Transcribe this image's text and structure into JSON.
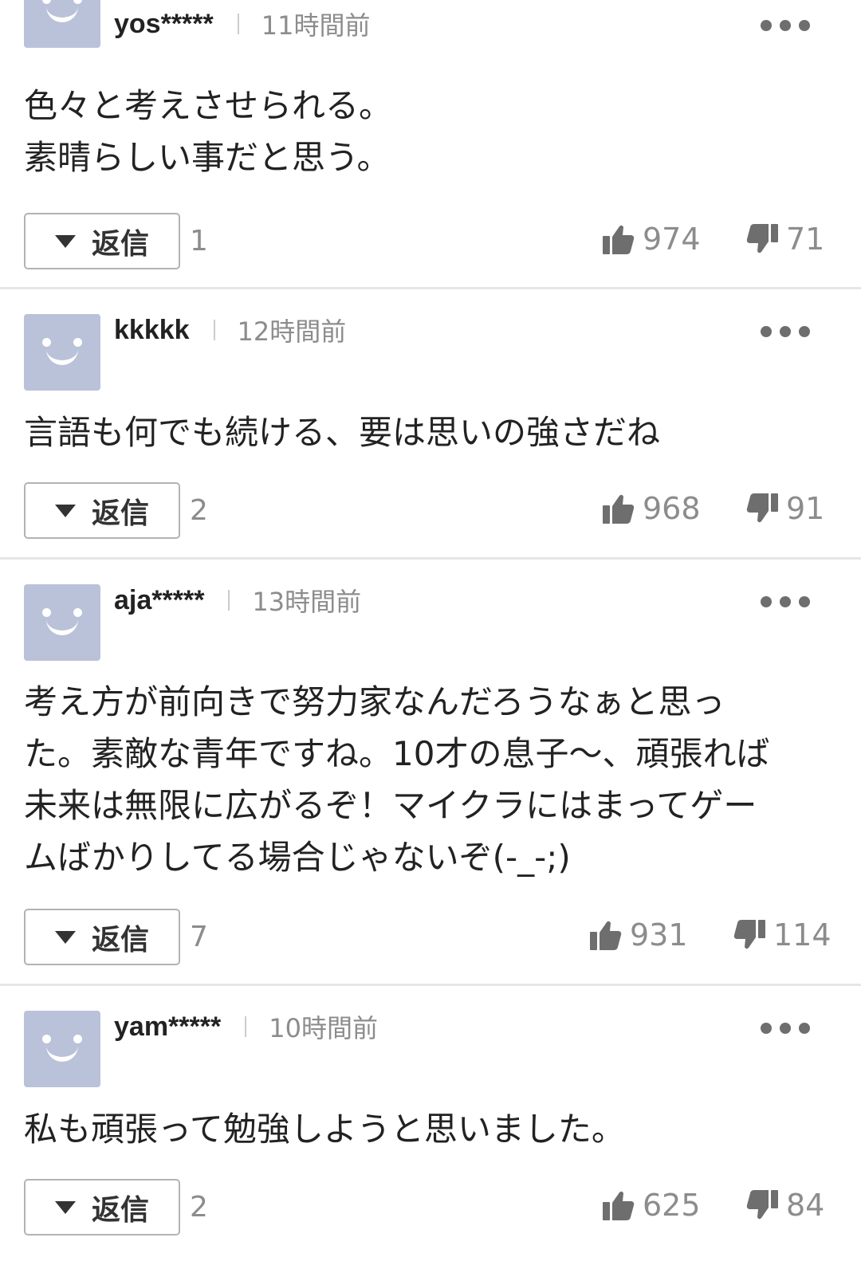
{
  "reply_label": "返信",
  "colors": {
    "avatar": "#b9c2d9",
    "divider": "#e6e6e6",
    "meta_text": "#8c8c8c",
    "icon": "#6e6e6e"
  },
  "icons": {
    "avatar": "smiley-avatar-icon",
    "more": "more-dots-icon",
    "reply_toggle": "triangle-down-icon",
    "like": "thumbs-up-icon",
    "dislike": "thumbs-down-icon"
  },
  "comments": [
    {
      "username": "yos*****",
      "time": "11時間前",
      "text": "色々と考えさせられる。\n素晴らしい事だと思う。",
      "reply_count": "1",
      "likes": "974",
      "dislikes": "71"
    },
    {
      "username": "kkkkk",
      "time": "12時間前",
      "text": "言語も何でも続ける、要は思いの強さだね",
      "reply_count": "2",
      "likes": "968",
      "dislikes": "91"
    },
    {
      "username": "aja*****",
      "time": "13時間前",
      "text": "考え方が前向きで努力家なんだろうなぁと思っ\nた。素敵な青年ですね。10才の息子〜、頑張れば\n未来は無限に広がるぞ！マイクラにはまってゲー\nムばかりしてる場合じゃないぞ(-_-;)",
      "reply_count": "7",
      "likes": "931",
      "dislikes": "114"
    },
    {
      "username": "yam*****",
      "time": "10時間前",
      "text": "私も頑張って勉強しようと思いました。",
      "reply_count": "2",
      "likes": "625",
      "dislikes": "84"
    }
  ]
}
